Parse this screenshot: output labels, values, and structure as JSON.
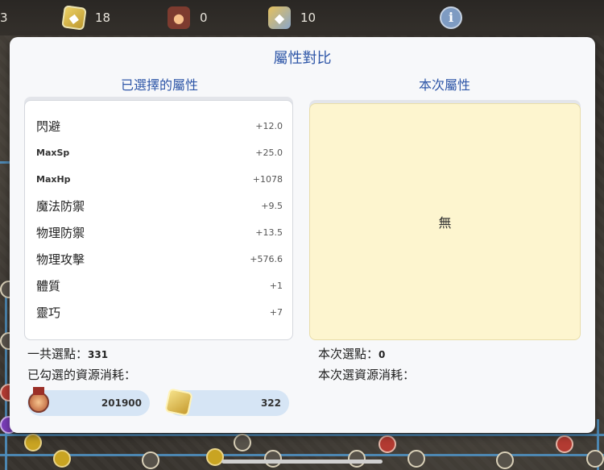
{
  "topbar": {
    "partial_count": "3",
    "items": [
      {
        "icon": "cube-icon",
        "count": "18"
      },
      {
        "icon": "badge-lock-icon",
        "count": "0"
      },
      {
        "icon": "cube-lock-icon",
        "count": "10"
      }
    ],
    "info_symbol": "i"
  },
  "modal": {
    "title": "屬性對比",
    "left_heading": "已選擇的屬性",
    "right_heading": "本次屬性",
    "attributes": [
      {
        "name": "閃避",
        "value": "+12.0"
      },
      {
        "name": "MaxSp",
        "value": "+25.0"
      },
      {
        "name": "MaxHp",
        "value": "+1078"
      },
      {
        "name": "魔法防禦",
        "value": "+9.5"
      },
      {
        "name": "物理防禦",
        "value": "+13.5"
      },
      {
        "name": "物理攻擊",
        "value": "+576.6"
      },
      {
        "name": "體質",
        "value": "+1"
      },
      {
        "name": "靈巧",
        "value": "+7"
      }
    ],
    "empty_text": "無",
    "total_points_label": "一共選點：",
    "total_points_value": "331",
    "consumed_label": "已勾選的資源消耗：",
    "current_points_label": "本次選點：",
    "current_points_value": "0",
    "current_consumed_label": "本次選資源消耗：",
    "costs": [
      {
        "icon": "medal-icon",
        "value": "201900"
      },
      {
        "icon": "gold-cube-icon",
        "value": "322"
      }
    ]
  }
}
